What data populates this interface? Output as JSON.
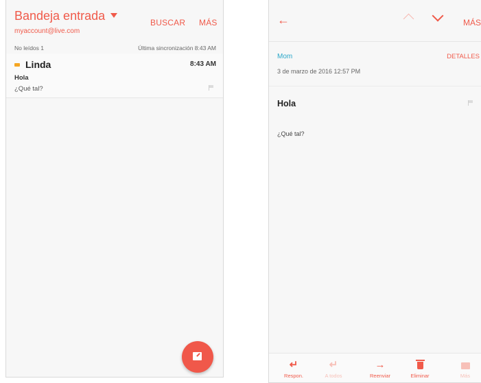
{
  "inbox": {
    "title": "Bandeja entrada",
    "account": "myaccount@live.com",
    "actions": {
      "search": "BUSCAR",
      "more": "MÁS"
    },
    "unread": "No leídos 1",
    "sync": "Última sincronización 8:43 AM",
    "messages": [
      {
        "sender": "Linda",
        "time": "8:43 AM",
        "subject": "Hola",
        "preview": "¿Qué tal?",
        "unread": true
      }
    ],
    "compose_icon": "compose-icon"
  },
  "detail": {
    "nav": {
      "back_icon": "back-arrow-icon",
      "prev_icon": "chevron-up-icon",
      "next_icon": "chevron-down-icon",
      "more": "MÁS"
    },
    "from": "Mom",
    "date": "3 de marzo de 2016  12:57 PM",
    "details_label": "DETALLES",
    "subject": "Hola",
    "body": "¿Qué tal?",
    "toolbar": [
      {
        "icon": "reply-icon",
        "label": "Respon.",
        "enabled": true
      },
      {
        "icon": "reply-all-icon",
        "label": "A todos",
        "enabled": false
      },
      {
        "icon": "forward-icon",
        "label": "Reenviar",
        "enabled": true
      },
      {
        "icon": "trash-icon",
        "label": "Eliminar",
        "enabled": true
      },
      {
        "icon": "more-icon",
        "label": "Más",
        "enabled": false
      }
    ]
  },
  "colors": {
    "accent": "#f05a4a",
    "link": "#2aa7c9",
    "unread_marker": "#f5a623"
  }
}
